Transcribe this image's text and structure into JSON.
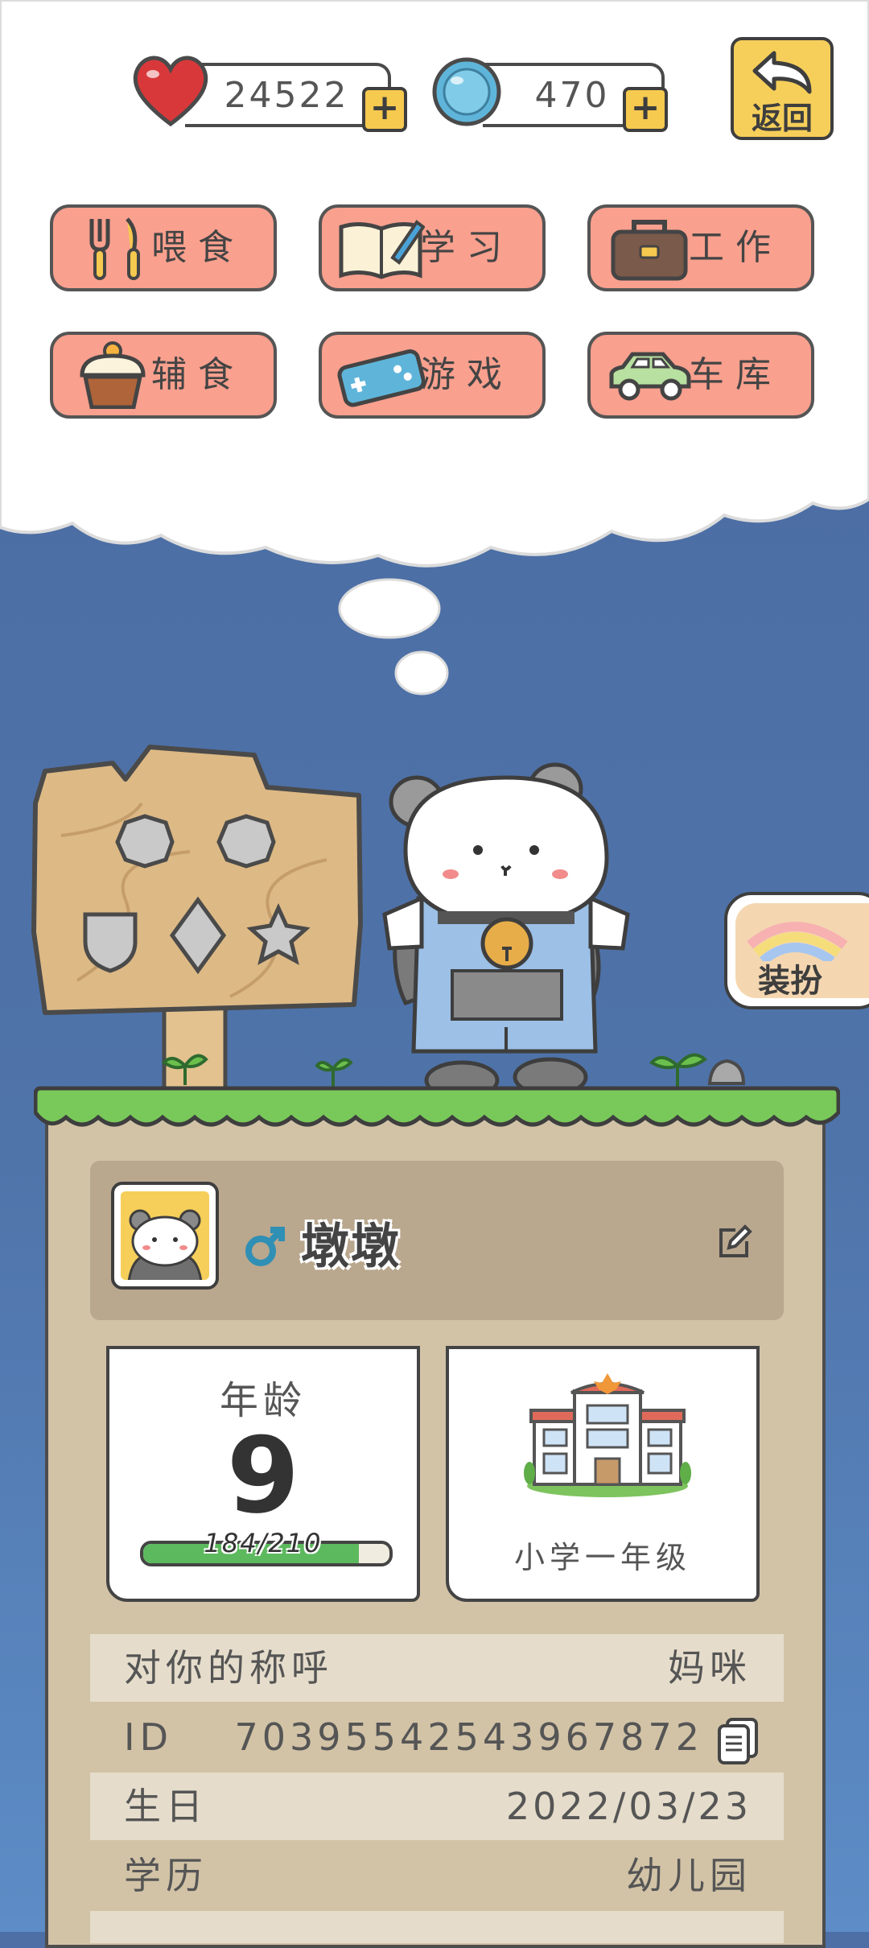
{
  "header": {
    "hearts": "24522",
    "coins": "470",
    "back_label": "返回"
  },
  "menu": [
    {
      "label": "喂食",
      "icon": "fork-knife-icon"
    },
    {
      "label": "学习",
      "icon": "book-icon"
    },
    {
      "label": "工作",
      "icon": "briefcase-icon"
    },
    {
      "label": "辅食",
      "icon": "cupcake-icon"
    },
    {
      "label": "游戏",
      "icon": "gamepad-icon"
    },
    {
      "label": "车库",
      "icon": "car-icon"
    }
  ],
  "dress_label": "装扮",
  "profile": {
    "name": "墩墩",
    "gender_icon": "male-icon",
    "age_label": "年龄",
    "age": "9",
    "age_progress_text": "184/210",
    "age_progress": 0.876,
    "school": "小学一年级"
  },
  "info": [
    {
      "key": "对你的称呼",
      "value": "妈咪"
    },
    {
      "key": "ID",
      "value": "70395542543967872"
    },
    {
      "key": "生日",
      "value": "2022/03/23"
    },
    {
      "key": "学历",
      "value": "幼儿园"
    }
  ],
  "colors": {
    "sky": "#4f74aa",
    "button": "#f9a08e",
    "card": "#d2c3a7",
    "grass": "#79c95a"
  }
}
